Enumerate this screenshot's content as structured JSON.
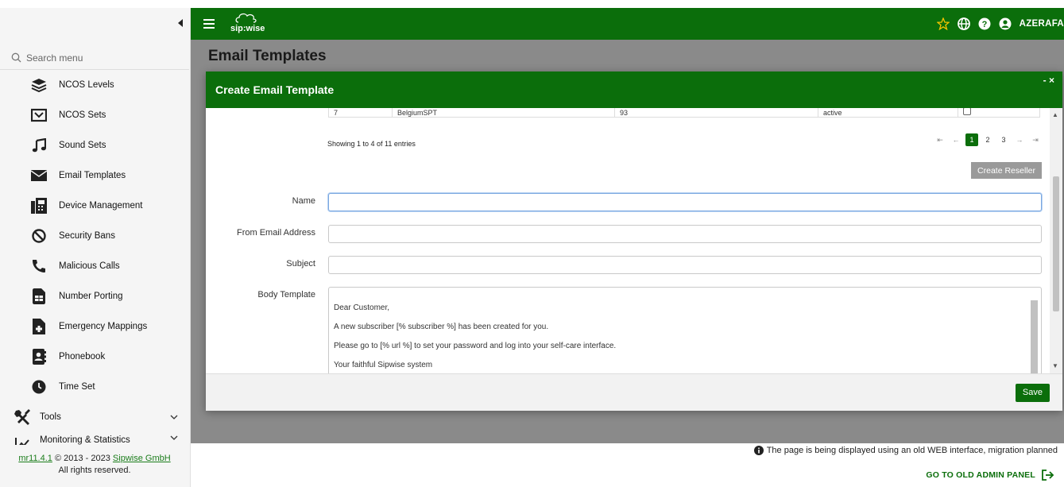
{
  "sidebar": {
    "search_placeholder": "Search menu",
    "items": [
      {
        "label": "NCOS Levels",
        "icon": "layers-icon"
      },
      {
        "label": "NCOS Sets",
        "icon": "ncos-sets-icon"
      },
      {
        "label": "Sound Sets",
        "icon": "music-note-icon"
      },
      {
        "label": "Email Templates",
        "icon": "envelope-icon"
      },
      {
        "label": "Device Management",
        "icon": "fax-icon"
      },
      {
        "label": "Security Bans",
        "icon": "ban-icon"
      },
      {
        "label": "Malicious Calls",
        "icon": "phone-icon"
      },
      {
        "label": "Number Porting",
        "icon": "sim-card-icon"
      },
      {
        "label": "Emergency Mappings",
        "icon": "file-medical-icon"
      },
      {
        "label": "Phonebook",
        "icon": "address-book-icon"
      },
      {
        "label": "Time Set",
        "icon": "clock-icon"
      }
    ],
    "tools_label": "Tools",
    "monitoring_label": "Monitoring & Statistics",
    "footer": {
      "version": "mr11.4.1",
      "copyright": "© 2013 - 2023",
      "company": "Sipwise GmbH",
      "rights": "All rights reserved."
    }
  },
  "topbar": {
    "logo_text": "sip:wise",
    "user": "AZERAFA"
  },
  "page": {
    "title": "Email Templates"
  },
  "modal": {
    "title": "Create Email Template",
    "controls": "- ×",
    "table_row": [
      "7",
      "BelgiumSPT",
      "93",
      "active"
    ],
    "showing": "Showing 1 to 4 of 11 entries",
    "pager": [
      "⇤",
      "←",
      "1",
      "2",
      "3",
      "→",
      "⇥"
    ],
    "create_reseller": "Create Reseller",
    "fields": {
      "name_label": "Name",
      "from_label": "From Email Address",
      "subject_label": "Subject",
      "body_label": "Body Template",
      "body_value": "Dear Customer,\n\nA new subscriber [% subscriber %] has been created for you.\n\nPlease go to [% url %] to set your password and log into your self-care interface.\n\nYour faithful Sipwise system"
    },
    "save_label": "Save"
  },
  "bottom": {
    "notice": "The page is being displayed using an old WEB interface, migration planned",
    "old_panel": "GO TO OLD ADMIN PANEL"
  },
  "colors": {
    "brand_green": "#0b6e0b",
    "overlay_gray": "#8a8a8a"
  }
}
